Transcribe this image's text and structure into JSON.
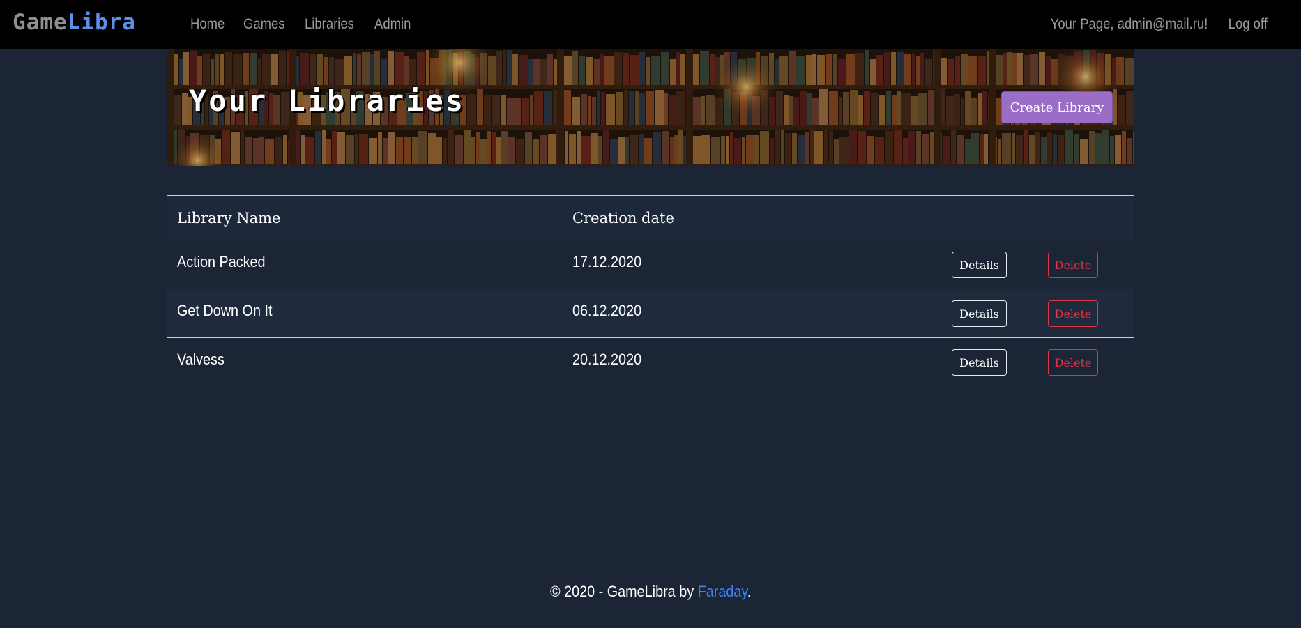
{
  "navbar": {
    "brand_part1": "Game",
    "brand_part2": "Libra",
    "links": [
      "Home",
      "Games",
      "Libraries",
      "Admin"
    ],
    "user_greeting": "Your Page, admin@mail.ru!",
    "logoff": "Log off"
  },
  "banner": {
    "title": "Your Libraries",
    "create_button": "Create Library"
  },
  "table": {
    "headers": {
      "name": "Library Name",
      "date": "Creation date"
    },
    "rows": [
      {
        "name": "Action Packed",
        "date": "17.12.2020",
        "details": "Details",
        "delete": "Delete"
      },
      {
        "name": "Get Down On It",
        "date": "06.12.2020",
        "details": "Details",
        "delete": "Delete"
      },
      {
        "name": "Valvess",
        "date": "20.12.2020",
        "details": "Details",
        "delete": "Delete"
      }
    ]
  },
  "footer": {
    "prefix": "© 2020 - GameLibra by ",
    "author_link": "Faraday",
    "suffix": "."
  },
  "colors": {
    "page_bg": "#1b2535",
    "accent_button": "#9b6dc6",
    "delete": "#dc3545",
    "link": "#3b82f6",
    "brand_blue": "#5b8fe8"
  }
}
